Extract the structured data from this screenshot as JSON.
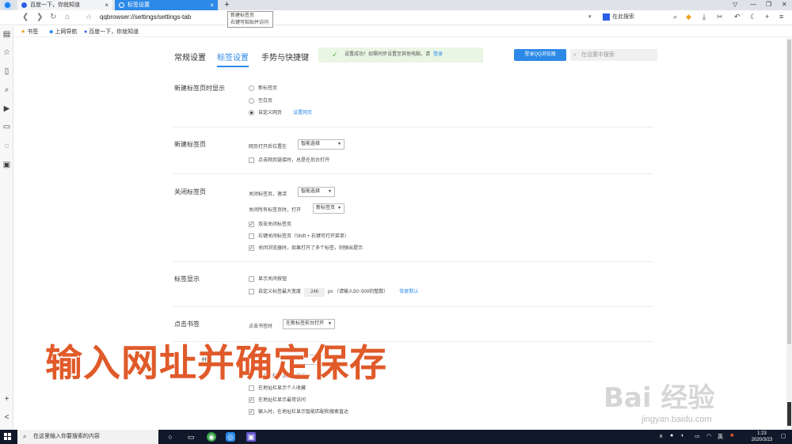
{
  "browser": {
    "tabs": [
      {
        "label": "百度一下，你就知道",
        "close": "×"
      },
      {
        "label": "标签设置",
        "close": "×"
      }
    ],
    "new_tab": "+",
    "tooltip_line1": "新建标签页",
    "tooltip_line2": "右键可粘贴并访问",
    "url": "qqbrowser://settings/settings-tab",
    "search_placeholder": "在此搜索",
    "bookmarks": [
      {
        "label": "书签"
      },
      {
        "label": "上网导航"
      },
      {
        "label": "百度一下，你就知道"
      }
    ]
  },
  "settings": {
    "nav": [
      "常规设置",
      "标签设置",
      "手势与快捷键"
    ],
    "notice_text": "设置成功！如需同步设置至其他电脑，请",
    "notice_link": "登录",
    "login_button": "登录QQ浏览器",
    "search_placeholder": "在设置中搜索",
    "sections": {
      "new_tab_display": {
        "title": "新建标签页时显示",
        "options": [
          "新标签页",
          "空白页",
          "自定义网页"
        ],
        "link": "设置网页"
      },
      "new_tab": {
        "title": "新建标签页",
        "open_position_label": "网页打开后位置在",
        "open_position_value": "智能选择",
        "option": "点击网页链接时，总是在后台打开"
      },
      "close_tab": {
        "title": "关闭标签页",
        "activate_label": "关闭标签页，激活",
        "activate_value": "智能选择",
        "close_all_label": "关闭所有标签页时，打开",
        "close_all_value": "新标签页",
        "options": [
          "双击关闭标签页",
          "右键关闭标签页（Shift + 右键可打开菜单）",
          "关闭浏览器时，如果打开了多个标签，则弹出提示"
        ]
      },
      "tab_display": {
        "title": "标签显示",
        "option1": "显示关闭按钮",
        "option2_prefix": "自定义标签最大宽度",
        "option2_value": "246",
        "option2_suffix": "px （请输入50~500的整数）",
        "restore": "恢复默认"
      },
      "click_bookmark": {
        "title": "点击书签",
        "label": "点击书签时",
        "value": "在新标签前台打开"
      },
      "address_bar": {
        "title_partial": "开",
        "label_partial": "地址",
        "value_partial": "在新",
        "options": [
          "在地址栏显示输入历史",
          "在地址栏显示个人收藏",
          "在地址栏显示最常访问",
          "输入时，在地址栏显示智能匹配和搜索直达"
        ]
      }
    }
  },
  "overlay_caption": "输入网址并确定保存",
  "watermark": "Bai 经验",
  "watermark_url": "jingyan.baidu.com",
  "taskbar": {
    "search_placeholder": "在这里输入你要搜索的内容",
    "ime": "英",
    "time": "1:23",
    "date": "2020/3/23"
  },
  "colors": {
    "accent": "#2c89e8",
    "overlay": "#e05a2a",
    "notice_bg": "#e9f6e3",
    "taskbar": "#10182a"
  }
}
